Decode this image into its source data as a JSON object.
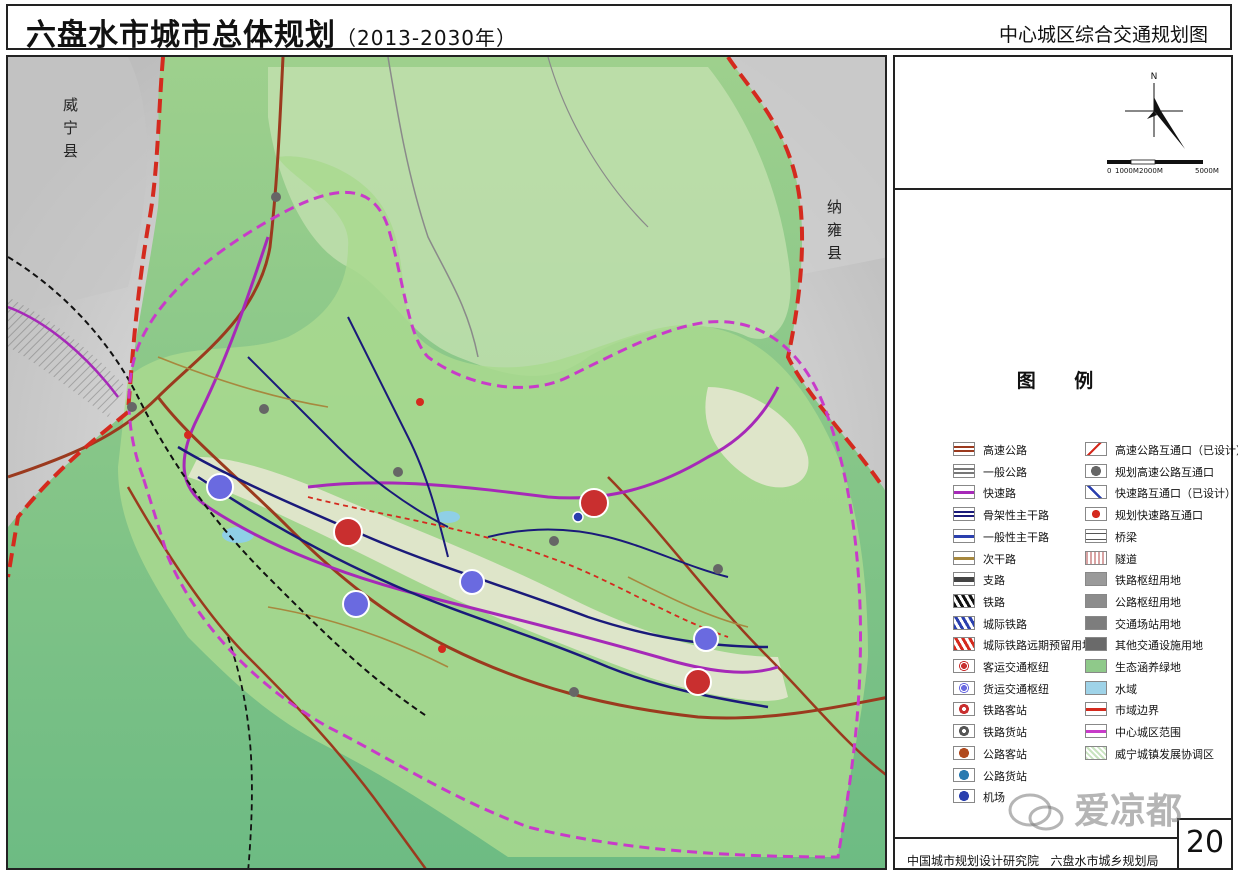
{
  "header": {
    "title": "六盘水市城市总体规划",
    "years": "（2013-2030年）",
    "subtitle": "中心城区综合交通规划图"
  },
  "map": {
    "label_west": "威宁县",
    "label_east": "纳雍县",
    "colors": {
      "terrain_green": "#8fc98a",
      "ecology_green": "#a9d98f",
      "boundary_red": "#d42a1e",
      "urban_boundary": "#c83bc9",
      "expressway_purple": "#a629b8",
      "main_road_navy": "#1a1a7a",
      "highway_brown": "#9b3a1e",
      "secondary_road": "#a7883e"
    }
  },
  "scale": {
    "north": "N",
    "labels": [
      "0",
      "1000M",
      "2000M",
      "5000M"
    ]
  },
  "legend": {
    "title": "图  例",
    "left": [
      {
        "label": "高速公路",
        "icon": "line-double-brown"
      },
      {
        "label": "一般公路",
        "icon": "line-double-grey"
      },
      {
        "label": "快速路",
        "icon": "line-purple"
      },
      {
        "label": "骨架性主干路",
        "icon": "line-navy-double"
      },
      {
        "label": "一般性主干路",
        "icon": "line-blue"
      },
      {
        "label": "次干路",
        "icon": "line-olive"
      },
      {
        "label": "支路",
        "icon": "line-dark-grey"
      },
      {
        "label": "铁路",
        "icon": "rail-hatch-black"
      },
      {
        "label": "城际铁路",
        "icon": "rail-hatch-blue"
      },
      {
        "label": "城际铁路远期预留用地",
        "icon": "rail-hatch-red"
      },
      {
        "label": "客运交通枢纽",
        "icon": "hub-red"
      },
      {
        "label": "货运交通枢纽",
        "icon": "hub-blue"
      },
      {
        "label": "铁路客站",
        "icon": "station-rail-pass"
      },
      {
        "label": "铁路货站",
        "icon": "station-rail-freight"
      },
      {
        "label": "公路客站",
        "icon": "station-road-pass"
      },
      {
        "label": "公路货站",
        "icon": "station-road-freight"
      },
      {
        "label": "机场",
        "icon": "airport"
      }
    ],
    "right": [
      {
        "label": "高速公路互通口（已设计）",
        "icon": "interchange-designed"
      },
      {
        "label": "规划高速公路互通口",
        "icon": "dot-grey"
      },
      {
        "label": "快速路互通口（已设计）",
        "icon": "interchange-express"
      },
      {
        "label": "规划快速路互通口",
        "icon": "dot-red"
      },
      {
        "label": "桥梁",
        "icon": "bridge"
      },
      {
        "label": "隧道",
        "icon": "tunnel"
      },
      {
        "label": "铁路枢纽用地",
        "icon": "fill-grey-1"
      },
      {
        "label": "公路枢纽用地",
        "icon": "fill-grey-2"
      },
      {
        "label": "交通场站用地",
        "icon": "fill-grey-3"
      },
      {
        "label": "其他交通设施用地",
        "icon": "fill-grey-4"
      },
      {
        "label": "生态涵养绿地",
        "icon": "fill-green"
      },
      {
        "label": "水域",
        "icon": "fill-water"
      },
      {
        "label": "市域边界",
        "icon": "line-city-boundary"
      },
      {
        "label": "中心城区范围",
        "icon": "line-center-boundary"
      },
      {
        "label": "威宁城镇发展协调区",
        "icon": "fill-hatch-coord"
      }
    ]
  },
  "footer": {
    "org1": "中国城市规划设计研究院",
    "org2": "六盘水市城乡规划局",
    "page": "20",
    "watermark": "爱凉都"
  }
}
